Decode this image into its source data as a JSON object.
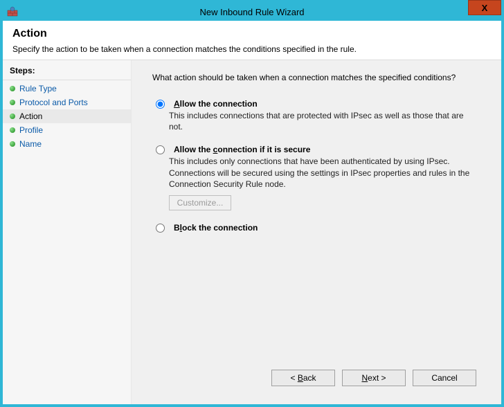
{
  "window": {
    "title": "New Inbound Rule Wizard",
    "close_label": "X"
  },
  "header": {
    "title": "Action",
    "subtitle": "Specify the action to be taken when a connection matches the conditions specified in the rule."
  },
  "steps": {
    "header": "Steps:",
    "items": [
      {
        "label": "Rule Type",
        "current": false
      },
      {
        "label": "Protocol and Ports",
        "current": false
      },
      {
        "label": "Action",
        "current": true
      },
      {
        "label": "Profile",
        "current": false
      },
      {
        "label": "Name",
        "current": false
      }
    ]
  },
  "content": {
    "question": "What action should be taken when a connection matches the specified conditions?",
    "options": {
      "allow": {
        "title_pre": "A",
        "title_post": "llow the connection",
        "desc": "This includes connections that are protected with IPsec as well as those that are not.",
        "selected": true
      },
      "allow_secure": {
        "title_pre": "Allow the ",
        "title_mid_ul": "c",
        "title_mid2": "onnection if it is secure",
        "desc": "This includes only connections that have been authenticated by using IPsec.  Connections will be secured using the settings in IPsec properties and rules in the Connection Security Rule node.",
        "customize_label": "Customize...",
        "selected": false
      },
      "block": {
        "title_pre": "B",
        "title_ul": "l",
        "title_post": "ock the connection",
        "selected": false
      }
    }
  },
  "footer": {
    "back_pre": "< ",
    "back_ul": "B",
    "back_post": "ack",
    "next_ul": "N",
    "next_post": "ext >",
    "cancel": "Cancel"
  }
}
